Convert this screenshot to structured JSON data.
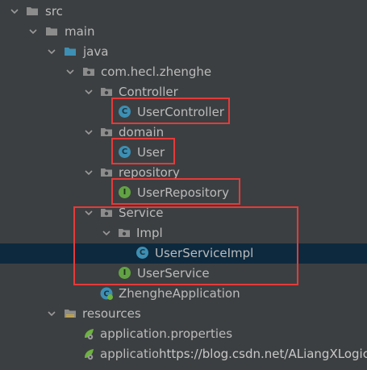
{
  "tree": {
    "src": "src",
    "main": "main",
    "java": "java",
    "package": "com.hecl.zhenghe",
    "controller_pkg": "Controller",
    "user_controller": "UserController",
    "domain_pkg": "domain",
    "user": "User",
    "repository_pkg": "repository",
    "user_repository": "UserRepository",
    "service_pkg": "Service",
    "impl_pkg": "Impl",
    "user_service_impl": "UserServiceImpl",
    "user_service": "UserService",
    "app_class": "ZhengheApplication",
    "resources": "resources",
    "app_props": "application.properties",
    "app_yml_partial": "application.yml"
  },
  "icons": {
    "class_letter": "C",
    "interface_letter": "I"
  },
  "watermark": "https://blog.csdn.net/ALiangXLogic",
  "colors": {
    "background": "#3c3f41",
    "selected_row": "#0d293e",
    "highlight_box": "#e53a3a",
    "class_icon": "#3d8fb3",
    "interface_icon": "#62a244",
    "folder_blue": "#3d8fb3"
  }
}
